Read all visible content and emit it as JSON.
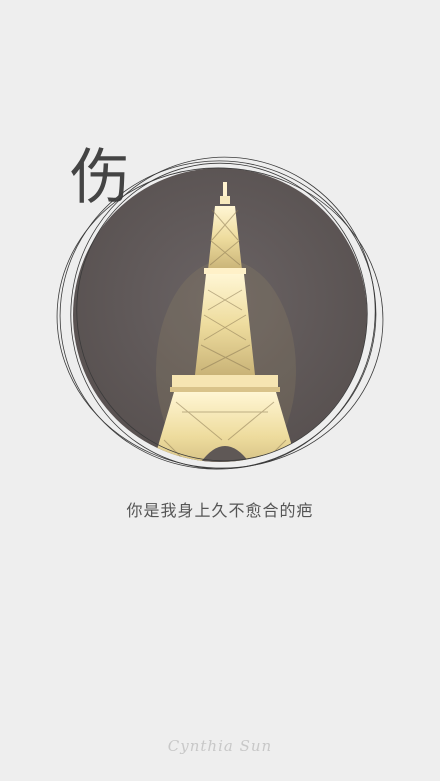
{
  "poster": {
    "title_char": "伤",
    "line": "你是我身上久不愈合的疤",
    "signature": "Cynthia Sun",
    "image": "eiffel-tower-at-night",
    "colors": {
      "background": "#eeeeee",
      "disc": "#625b5c",
      "tower_glow": "#f3e3b0"
    }
  }
}
